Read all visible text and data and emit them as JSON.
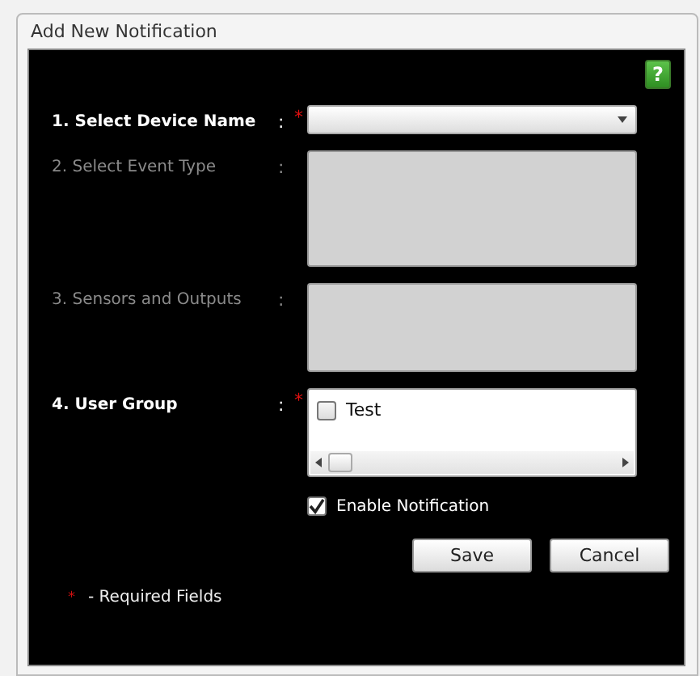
{
  "window": {
    "title": "Add New Notification"
  },
  "help_button": {
    "label": "?"
  },
  "fields": [
    {
      "number": "1.",
      "label": "Select Device Name",
      "colon": ":",
      "required": true,
      "disabled": false,
      "kind": "dropdown"
    },
    {
      "number": "2.",
      "label": "Select Event Type",
      "colon": ":",
      "required": false,
      "disabled": true,
      "kind": "box"
    },
    {
      "number": "3.",
      "label": "Sensors and Outputs",
      "colon": ":",
      "required": false,
      "disabled": true,
      "kind": "box"
    },
    {
      "number": "4.",
      "label": "User Group",
      "colon": ":",
      "required": true,
      "disabled": false,
      "kind": "checklist",
      "items": [
        {
          "label": "Test",
          "checked": false
        }
      ]
    }
  ],
  "enable_notification": {
    "label": "Enable Notification",
    "checked": true
  },
  "buttons": [
    "Save",
    "Cancel"
  ],
  "legend": {
    "mark": "*",
    "text": "- Required Fields"
  }
}
